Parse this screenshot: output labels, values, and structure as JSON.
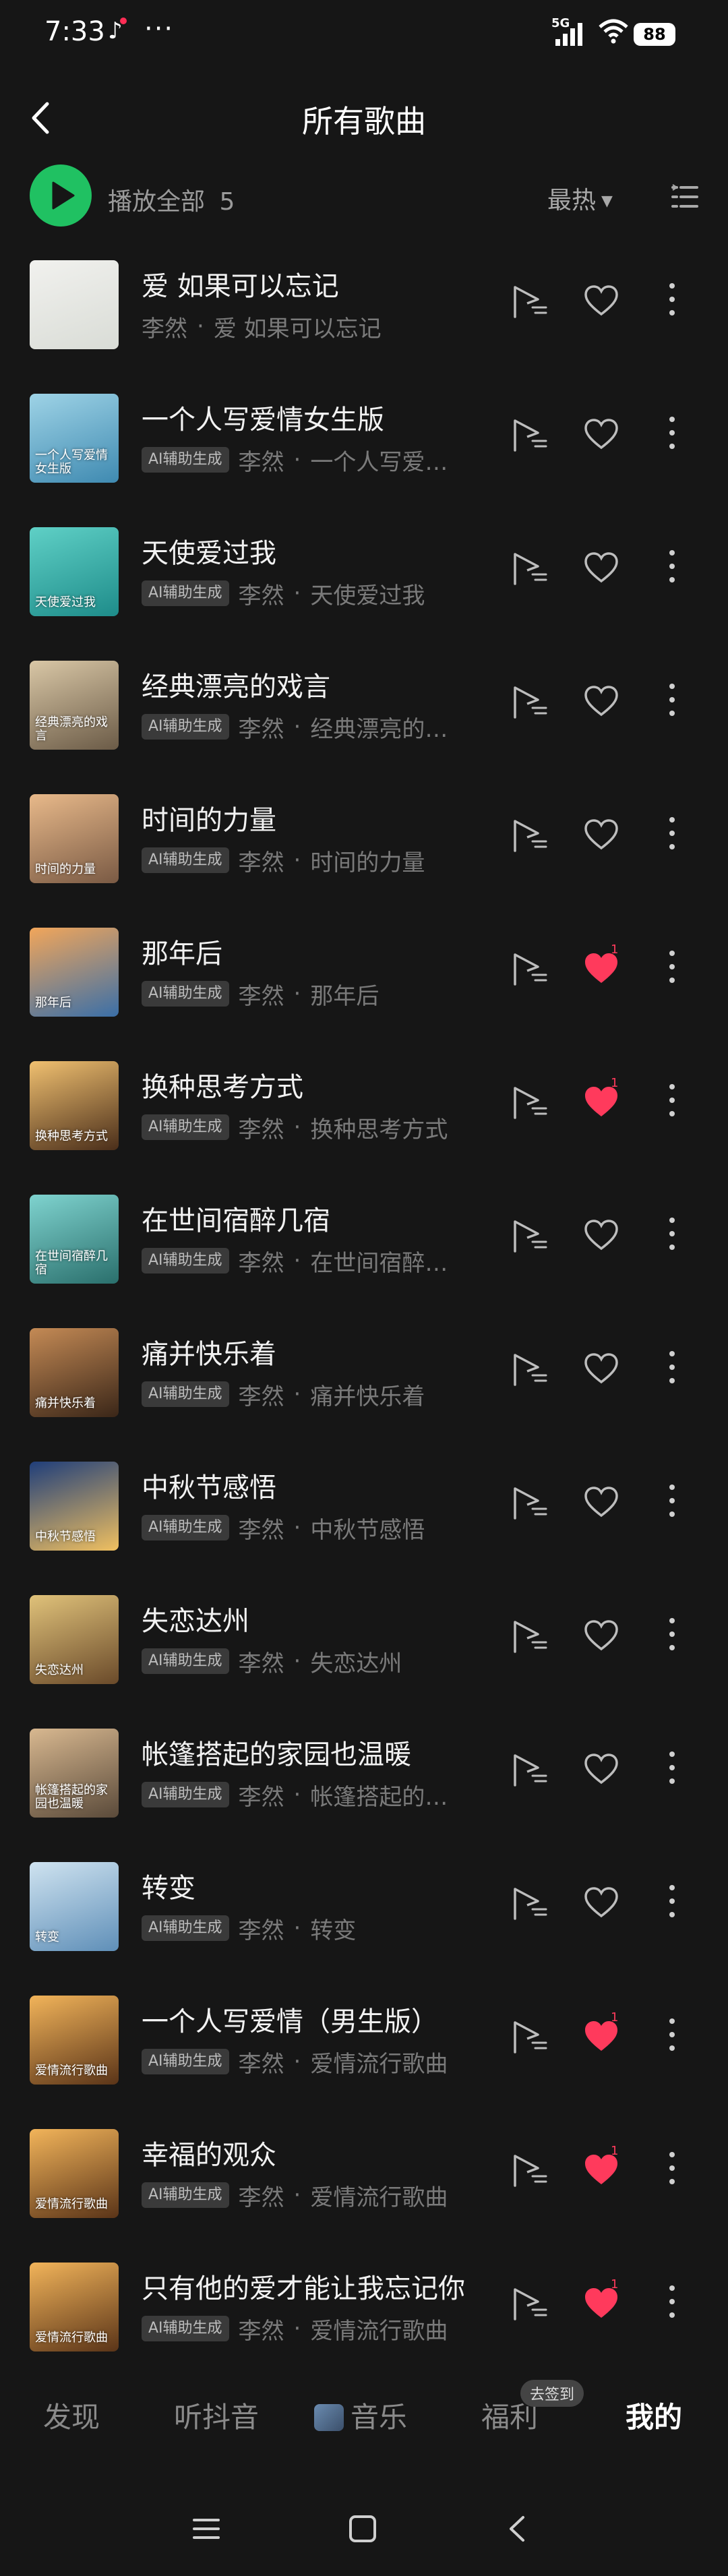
{
  "status_bar": {
    "time": "7:33",
    "app_icon": "tiktok-icon",
    "more": "···",
    "network": "5G",
    "battery": "88"
  },
  "header": {
    "title": "所有歌曲",
    "back_icon": "back-icon"
  },
  "toolbar": {
    "play_all_label": "播放全部",
    "play_all_count": "5",
    "sort_label": "最热",
    "list_settings_icon": "list-settings-icon"
  },
  "colors": {
    "background": "#161616",
    "accent_green": "#20c162",
    "like_red": "#ff3a5c",
    "text_secondary": "#7a7a7a"
  },
  "songs": [
    {
      "title": "爱 如果可以忘记",
      "ai": false,
      "ai_label": "",
      "artist": "李然",
      "album": "爱 如果可以忘记",
      "liked": false,
      "like_count": "",
      "cover_caption": "",
      "cover_colors": [
        "#f1f1ee",
        "#d9dcd6"
      ]
    },
    {
      "title": "一个人写爱情女生版",
      "ai": true,
      "ai_label": "AI辅助生成",
      "artist": "李然",
      "album": "一个人写爱…",
      "liked": false,
      "like_count": "",
      "cover_caption": "一个人写爱情女生版",
      "cover_colors": [
        "#9ed3e6",
        "#3f8ab1"
      ]
    },
    {
      "title": "天使爱过我",
      "ai": true,
      "ai_label": "AI辅助生成",
      "artist": "李然",
      "album": "天使爱过我",
      "liked": false,
      "like_count": "",
      "cover_caption": "天使爱过我",
      "cover_colors": [
        "#5fd0c6",
        "#1e8c8a"
      ]
    },
    {
      "title": "经典漂亮的戏言",
      "ai": true,
      "ai_label": "AI辅助生成",
      "artist": "李然",
      "album": "经典漂亮的…",
      "liked": false,
      "like_count": "",
      "cover_caption": "经典漂亮的戏言",
      "cover_colors": [
        "#d9c7a6",
        "#6b5b47"
      ]
    },
    {
      "title": "时间的力量",
      "ai": true,
      "ai_label": "AI辅助生成",
      "artist": "李然",
      "album": "时间的力量",
      "liked": false,
      "like_count": "",
      "cover_caption": "时间的力量",
      "cover_colors": [
        "#e8b98a",
        "#7a5a44"
      ]
    },
    {
      "title": "那年后",
      "ai": true,
      "ai_label": "AI辅助生成",
      "artist": "李然",
      "album": "那年后",
      "liked": true,
      "like_count": "1",
      "cover_caption": "那年后",
      "cover_colors": [
        "#f2a65a",
        "#3a6fa8"
      ]
    },
    {
      "title": "换种思考方式",
      "ai": true,
      "ai_label": "AI辅助生成",
      "artist": "李然",
      "album": "换种思考方式",
      "liked": true,
      "like_count": "1",
      "cover_caption": "换种思考方式",
      "cover_colors": [
        "#f0c070",
        "#4a2e1a"
      ]
    },
    {
      "title": "在世间宿醉几宿",
      "ai": true,
      "ai_label": "AI辅助生成",
      "artist": "李然",
      "album": "在世间宿醉…",
      "liked": false,
      "like_count": "",
      "cover_caption": "在世间宿醉几宿",
      "cover_colors": [
        "#7fd3cf",
        "#2a6f6c"
      ]
    },
    {
      "title": "痛并快乐着",
      "ai": true,
      "ai_label": "AI辅助生成",
      "artist": "李然",
      "album": "痛并快乐着",
      "liked": false,
      "like_count": "",
      "cover_caption": "痛并快乐着",
      "cover_colors": [
        "#c48a55",
        "#3a2618"
      ]
    },
    {
      "title": "中秋节感悟",
      "ai": true,
      "ai_label": "AI辅助生成",
      "artist": "李然",
      "album": "中秋节感悟",
      "liked": false,
      "like_count": "",
      "cover_caption": "中秋节感悟",
      "cover_colors": [
        "#1f3e7a",
        "#f0c060"
      ]
    },
    {
      "title": "失恋达州",
      "ai": true,
      "ai_label": "AI辅助生成",
      "artist": "李然",
      "album": "失恋达州",
      "liked": false,
      "like_count": "",
      "cover_caption": "失恋达州",
      "cover_colors": [
        "#e0c27a",
        "#6a4a2a"
      ]
    },
    {
      "title": "帐篷搭起的家园也温暖",
      "ai": true,
      "ai_label": "AI辅助生成",
      "artist": "李然",
      "album": "帐篷搭起的…",
      "liked": false,
      "like_count": "",
      "cover_caption": "帐篷搭起的家园也温暖",
      "cover_colors": [
        "#d8b890",
        "#5a4a3a"
      ]
    },
    {
      "title": "转变",
      "ai": true,
      "ai_label": "AI辅助生成",
      "artist": "李然",
      "album": "转变",
      "liked": false,
      "like_count": "",
      "cover_caption": "转变",
      "cover_colors": [
        "#cfe3f0",
        "#5f8fb8"
      ]
    },
    {
      "title": "一个人写爱情（男生版）",
      "ai": true,
      "ai_label": "AI辅助生成",
      "artist": "李然",
      "album": "爱情流行歌曲",
      "liked": true,
      "like_count": "1",
      "cover_caption": "爱情流行歌曲",
      "cover_colors": [
        "#f2b45a",
        "#5a3418"
      ]
    },
    {
      "title": "幸福的观众",
      "ai": true,
      "ai_label": "AI辅助生成",
      "artist": "李然",
      "album": "爱情流行歌曲",
      "liked": true,
      "like_count": "1",
      "cover_caption": "爱情流行歌曲",
      "cover_colors": [
        "#f2b45a",
        "#5a3418"
      ]
    },
    {
      "title": "只有他的爱才能让我忘记你",
      "ai": true,
      "ai_label": "AI辅助生成",
      "artist": "李然",
      "album": "爱情流行歌曲",
      "liked": true,
      "like_count": "1",
      "cover_caption": "爱情流行歌曲",
      "cover_colors": [
        "#f2b45a",
        "#5a3418"
      ]
    }
  ],
  "bottom_nav": {
    "items": [
      "发现",
      "听抖音",
      "音乐",
      "福利",
      "我的"
    ],
    "active": "我的",
    "badge": "去签到"
  }
}
